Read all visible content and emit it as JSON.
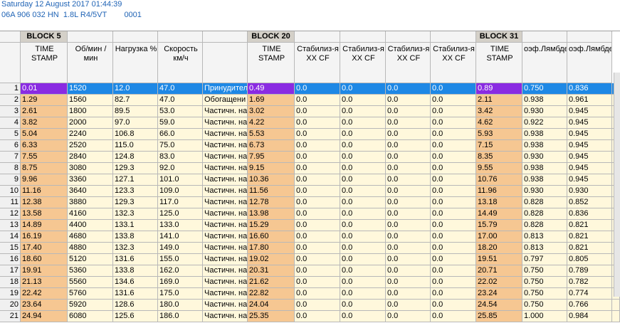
{
  "header": {
    "datetime": "Saturday 12 August 2017 01:44:39",
    "ecu_line": "06A 906 032 HN  1.8L R4/5VT        0001"
  },
  "blocks": [
    "BLOCK 5",
    "BLOCK 20",
    "BLOCK 31"
  ],
  "columns": [
    "TIME STAMP",
    "Об/мин /мин",
    "Нагрузка %",
    "Скорость км/ч",
    "",
    "TIME STAMP",
    "Стабилиз-я XX CF",
    "Стабилиз-я XX CF",
    "Стабилиз-я XX CF",
    "Стабилиз-я XX CF",
    "TIME STAMP",
    "оэф.Лямбде",
    "оэф.Лямбде"
  ],
  "rows": [
    [
      "1",
      "0.01",
      "1520",
      "12.0",
      "47.0",
      "Принудител",
      "0.49",
      "0.0",
      "0.0",
      "0.0",
      "0.0",
      "0.89",
      "0.750",
      "0.836"
    ],
    [
      "2",
      "1.29",
      "1560",
      "82.7",
      "47.0",
      "Обогащени",
      "1.69",
      "0.0",
      "0.0",
      "0.0",
      "0.0",
      "2.11",
      "0.938",
      "0.961"
    ],
    [
      "3",
      "2.61",
      "1800",
      "89.5",
      "53.0",
      "Частичн. на",
      "3.02",
      "0.0",
      "0.0",
      "0.0",
      "0.0",
      "3.42",
      "0.930",
      "0.945"
    ],
    [
      "4",
      "3.82",
      "2000",
      "97.0",
      "59.0",
      "Частичн. на",
      "4.22",
      "0.0",
      "0.0",
      "0.0",
      "0.0",
      "4.62",
      "0.922",
      "0.945"
    ],
    [
      "5",
      "5.04",
      "2240",
      "106.8",
      "66.0",
      "Частичн. на",
      "5.53",
      "0.0",
      "0.0",
      "0.0",
      "0.0",
      "5.93",
      "0.938",
      "0.945"
    ],
    [
      "6",
      "6.33",
      "2520",
      "115.0",
      "75.0",
      "Частичн. на",
      "6.73",
      "0.0",
      "0.0",
      "0.0",
      "0.0",
      "7.15",
      "0.938",
      "0.945"
    ],
    [
      "7",
      "7.55",
      "2840",
      "124.8",
      "83.0",
      "Частичн. на",
      "7.95",
      "0.0",
      "0.0",
      "0.0",
      "0.0",
      "8.35",
      "0.930",
      "0.945"
    ],
    [
      "8",
      "8.75",
      "3080",
      "129.3",
      "92.0",
      "Частичн. на",
      "9.15",
      "0.0",
      "0.0",
      "0.0",
      "0.0",
      "9.55",
      "0.938",
      "0.945"
    ],
    [
      "9",
      "9.96",
      "3360",
      "127.1",
      "101.0",
      "Частичн. на",
      "10.36",
      "0.0",
      "0.0",
      "0.0",
      "0.0",
      "10.76",
      "0.938",
      "0.945"
    ],
    [
      "10",
      "11.16",
      "3640",
      "123.3",
      "109.0",
      "Частичн. на",
      "11.56",
      "0.0",
      "0.0",
      "0.0",
      "0.0",
      "11.96",
      "0.930",
      "0.930"
    ],
    [
      "11",
      "12.38",
      "3880",
      "129.3",
      "117.0",
      "Частичн. на",
      "12.78",
      "0.0",
      "0.0",
      "0.0",
      "0.0",
      "13.18",
      "0.828",
      "0.852"
    ],
    [
      "12",
      "13.58",
      "4160",
      "132.3",
      "125.0",
      "Частичн. на",
      "13.98",
      "0.0",
      "0.0",
      "0.0",
      "0.0",
      "14.49",
      "0.828",
      "0.836"
    ],
    [
      "13",
      "14.89",
      "4400",
      "133.1",
      "133.0",
      "Частичн. на",
      "15.29",
      "0.0",
      "0.0",
      "0.0",
      "0.0",
      "15.79",
      "0.828",
      "0.821"
    ],
    [
      "14",
      "16.19",
      "4680",
      "133.8",
      "141.0",
      "Частичн. на",
      "16.60",
      "0.0",
      "0.0",
      "0.0",
      "0.0",
      "17.00",
      "0.813",
      "0.821"
    ],
    [
      "15",
      "17.40",
      "4880",
      "132.3",
      "149.0",
      "Частичн. на",
      "17.80",
      "0.0",
      "0.0",
      "0.0",
      "0.0",
      "18.20",
      "0.813",
      "0.821"
    ],
    [
      "16",
      "18.60",
      "5120",
      "131.6",
      "155.0",
      "Частичн. на",
      "19.02",
      "0.0",
      "0.0",
      "0.0",
      "0.0",
      "19.51",
      "0.797",
      "0.805"
    ],
    [
      "17",
      "19.91",
      "5360",
      "133.8",
      "162.0",
      "Частичн. на",
      "20.31",
      "0.0",
      "0.0",
      "0.0",
      "0.0",
      "20.71",
      "0.750",
      "0.789"
    ],
    [
      "18",
      "21.13",
      "5560",
      "134.6",
      "169.0",
      "Частичн. на",
      "21.62",
      "0.0",
      "0.0",
      "0.0",
      "0.0",
      "22.02",
      "0.750",
      "0.782"
    ],
    [
      "19",
      "22.42",
      "5760",
      "131.6",
      "175.0",
      "Частичн. на",
      "22.82",
      "0.0",
      "0.0",
      "0.0",
      "0.0",
      "23.24",
      "0.750",
      "0.774"
    ],
    [
      "20",
      "23.64",
      "5920",
      "128.6",
      "180.0",
      "Частичн. на",
      "24.04",
      "0.0",
      "0.0",
      "0.0",
      "0.0",
      "24.54",
      "0.750",
      "0.766"
    ],
    [
      "21",
      "24.94",
      "6080",
      "125.6",
      "186.0",
      "Частичн. на",
      "25.35",
      "0.0",
      "0.0",
      "0.0",
      "0.0",
      "25.85",
      "1.000",
      "0.984"
    ]
  ],
  "selected_row": 1
}
